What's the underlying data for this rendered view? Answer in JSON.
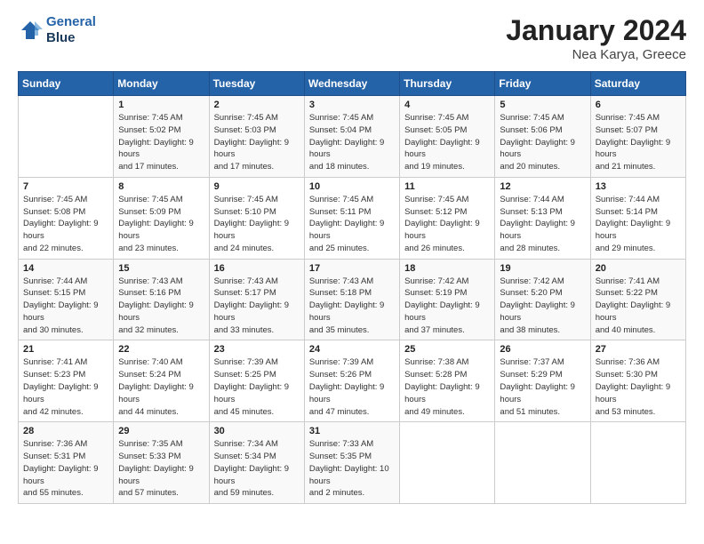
{
  "header": {
    "logo_line1": "General",
    "logo_line2": "Blue",
    "title": "January 2024",
    "subtitle": "Nea Karya, Greece"
  },
  "days_of_week": [
    "Sunday",
    "Monday",
    "Tuesday",
    "Wednesday",
    "Thursday",
    "Friday",
    "Saturday"
  ],
  "weeks": [
    [
      {
        "day": "",
        "sunrise": "",
        "sunset": "",
        "daylight": ""
      },
      {
        "day": "1",
        "sunrise": "Sunrise: 7:45 AM",
        "sunset": "Sunset: 5:02 PM",
        "daylight": "Daylight: 9 hours and 17 minutes."
      },
      {
        "day": "2",
        "sunrise": "Sunrise: 7:45 AM",
        "sunset": "Sunset: 5:03 PM",
        "daylight": "Daylight: 9 hours and 17 minutes."
      },
      {
        "day": "3",
        "sunrise": "Sunrise: 7:45 AM",
        "sunset": "Sunset: 5:04 PM",
        "daylight": "Daylight: 9 hours and 18 minutes."
      },
      {
        "day": "4",
        "sunrise": "Sunrise: 7:45 AM",
        "sunset": "Sunset: 5:05 PM",
        "daylight": "Daylight: 9 hours and 19 minutes."
      },
      {
        "day": "5",
        "sunrise": "Sunrise: 7:45 AM",
        "sunset": "Sunset: 5:06 PM",
        "daylight": "Daylight: 9 hours and 20 minutes."
      },
      {
        "day": "6",
        "sunrise": "Sunrise: 7:45 AM",
        "sunset": "Sunset: 5:07 PM",
        "daylight": "Daylight: 9 hours and 21 minutes."
      }
    ],
    [
      {
        "day": "7",
        "sunrise": "Sunrise: 7:45 AM",
        "sunset": "Sunset: 5:08 PM",
        "daylight": "Daylight: 9 hours and 22 minutes."
      },
      {
        "day": "8",
        "sunrise": "Sunrise: 7:45 AM",
        "sunset": "Sunset: 5:09 PM",
        "daylight": "Daylight: 9 hours and 23 minutes."
      },
      {
        "day": "9",
        "sunrise": "Sunrise: 7:45 AM",
        "sunset": "Sunset: 5:10 PM",
        "daylight": "Daylight: 9 hours and 24 minutes."
      },
      {
        "day": "10",
        "sunrise": "Sunrise: 7:45 AM",
        "sunset": "Sunset: 5:11 PM",
        "daylight": "Daylight: 9 hours and 25 minutes."
      },
      {
        "day": "11",
        "sunrise": "Sunrise: 7:45 AM",
        "sunset": "Sunset: 5:12 PM",
        "daylight": "Daylight: 9 hours and 26 minutes."
      },
      {
        "day": "12",
        "sunrise": "Sunrise: 7:44 AM",
        "sunset": "Sunset: 5:13 PM",
        "daylight": "Daylight: 9 hours and 28 minutes."
      },
      {
        "day": "13",
        "sunrise": "Sunrise: 7:44 AM",
        "sunset": "Sunset: 5:14 PM",
        "daylight": "Daylight: 9 hours and 29 minutes."
      }
    ],
    [
      {
        "day": "14",
        "sunrise": "Sunrise: 7:44 AM",
        "sunset": "Sunset: 5:15 PM",
        "daylight": "Daylight: 9 hours and 30 minutes."
      },
      {
        "day": "15",
        "sunrise": "Sunrise: 7:43 AM",
        "sunset": "Sunset: 5:16 PM",
        "daylight": "Daylight: 9 hours and 32 minutes."
      },
      {
        "day": "16",
        "sunrise": "Sunrise: 7:43 AM",
        "sunset": "Sunset: 5:17 PM",
        "daylight": "Daylight: 9 hours and 33 minutes."
      },
      {
        "day": "17",
        "sunrise": "Sunrise: 7:43 AM",
        "sunset": "Sunset: 5:18 PM",
        "daylight": "Daylight: 9 hours and 35 minutes."
      },
      {
        "day": "18",
        "sunrise": "Sunrise: 7:42 AM",
        "sunset": "Sunset: 5:19 PM",
        "daylight": "Daylight: 9 hours and 37 minutes."
      },
      {
        "day": "19",
        "sunrise": "Sunrise: 7:42 AM",
        "sunset": "Sunset: 5:20 PM",
        "daylight": "Daylight: 9 hours and 38 minutes."
      },
      {
        "day": "20",
        "sunrise": "Sunrise: 7:41 AM",
        "sunset": "Sunset: 5:22 PM",
        "daylight": "Daylight: 9 hours and 40 minutes."
      }
    ],
    [
      {
        "day": "21",
        "sunrise": "Sunrise: 7:41 AM",
        "sunset": "Sunset: 5:23 PM",
        "daylight": "Daylight: 9 hours and 42 minutes."
      },
      {
        "day": "22",
        "sunrise": "Sunrise: 7:40 AM",
        "sunset": "Sunset: 5:24 PM",
        "daylight": "Daylight: 9 hours and 44 minutes."
      },
      {
        "day": "23",
        "sunrise": "Sunrise: 7:39 AM",
        "sunset": "Sunset: 5:25 PM",
        "daylight": "Daylight: 9 hours and 45 minutes."
      },
      {
        "day": "24",
        "sunrise": "Sunrise: 7:39 AM",
        "sunset": "Sunset: 5:26 PM",
        "daylight": "Daylight: 9 hours and 47 minutes."
      },
      {
        "day": "25",
        "sunrise": "Sunrise: 7:38 AM",
        "sunset": "Sunset: 5:28 PM",
        "daylight": "Daylight: 9 hours and 49 minutes."
      },
      {
        "day": "26",
        "sunrise": "Sunrise: 7:37 AM",
        "sunset": "Sunset: 5:29 PM",
        "daylight": "Daylight: 9 hours and 51 minutes."
      },
      {
        "day": "27",
        "sunrise": "Sunrise: 7:36 AM",
        "sunset": "Sunset: 5:30 PM",
        "daylight": "Daylight: 9 hours and 53 minutes."
      }
    ],
    [
      {
        "day": "28",
        "sunrise": "Sunrise: 7:36 AM",
        "sunset": "Sunset: 5:31 PM",
        "daylight": "Daylight: 9 hours and 55 minutes."
      },
      {
        "day": "29",
        "sunrise": "Sunrise: 7:35 AM",
        "sunset": "Sunset: 5:33 PM",
        "daylight": "Daylight: 9 hours and 57 minutes."
      },
      {
        "day": "30",
        "sunrise": "Sunrise: 7:34 AM",
        "sunset": "Sunset: 5:34 PM",
        "daylight": "Daylight: 9 hours and 59 minutes."
      },
      {
        "day": "31",
        "sunrise": "Sunrise: 7:33 AM",
        "sunset": "Sunset: 5:35 PM",
        "daylight": "Daylight: 10 hours and 2 minutes."
      },
      {
        "day": "",
        "sunrise": "",
        "sunset": "",
        "daylight": ""
      },
      {
        "day": "",
        "sunrise": "",
        "sunset": "",
        "daylight": ""
      },
      {
        "day": "",
        "sunrise": "",
        "sunset": "",
        "daylight": ""
      }
    ]
  ]
}
